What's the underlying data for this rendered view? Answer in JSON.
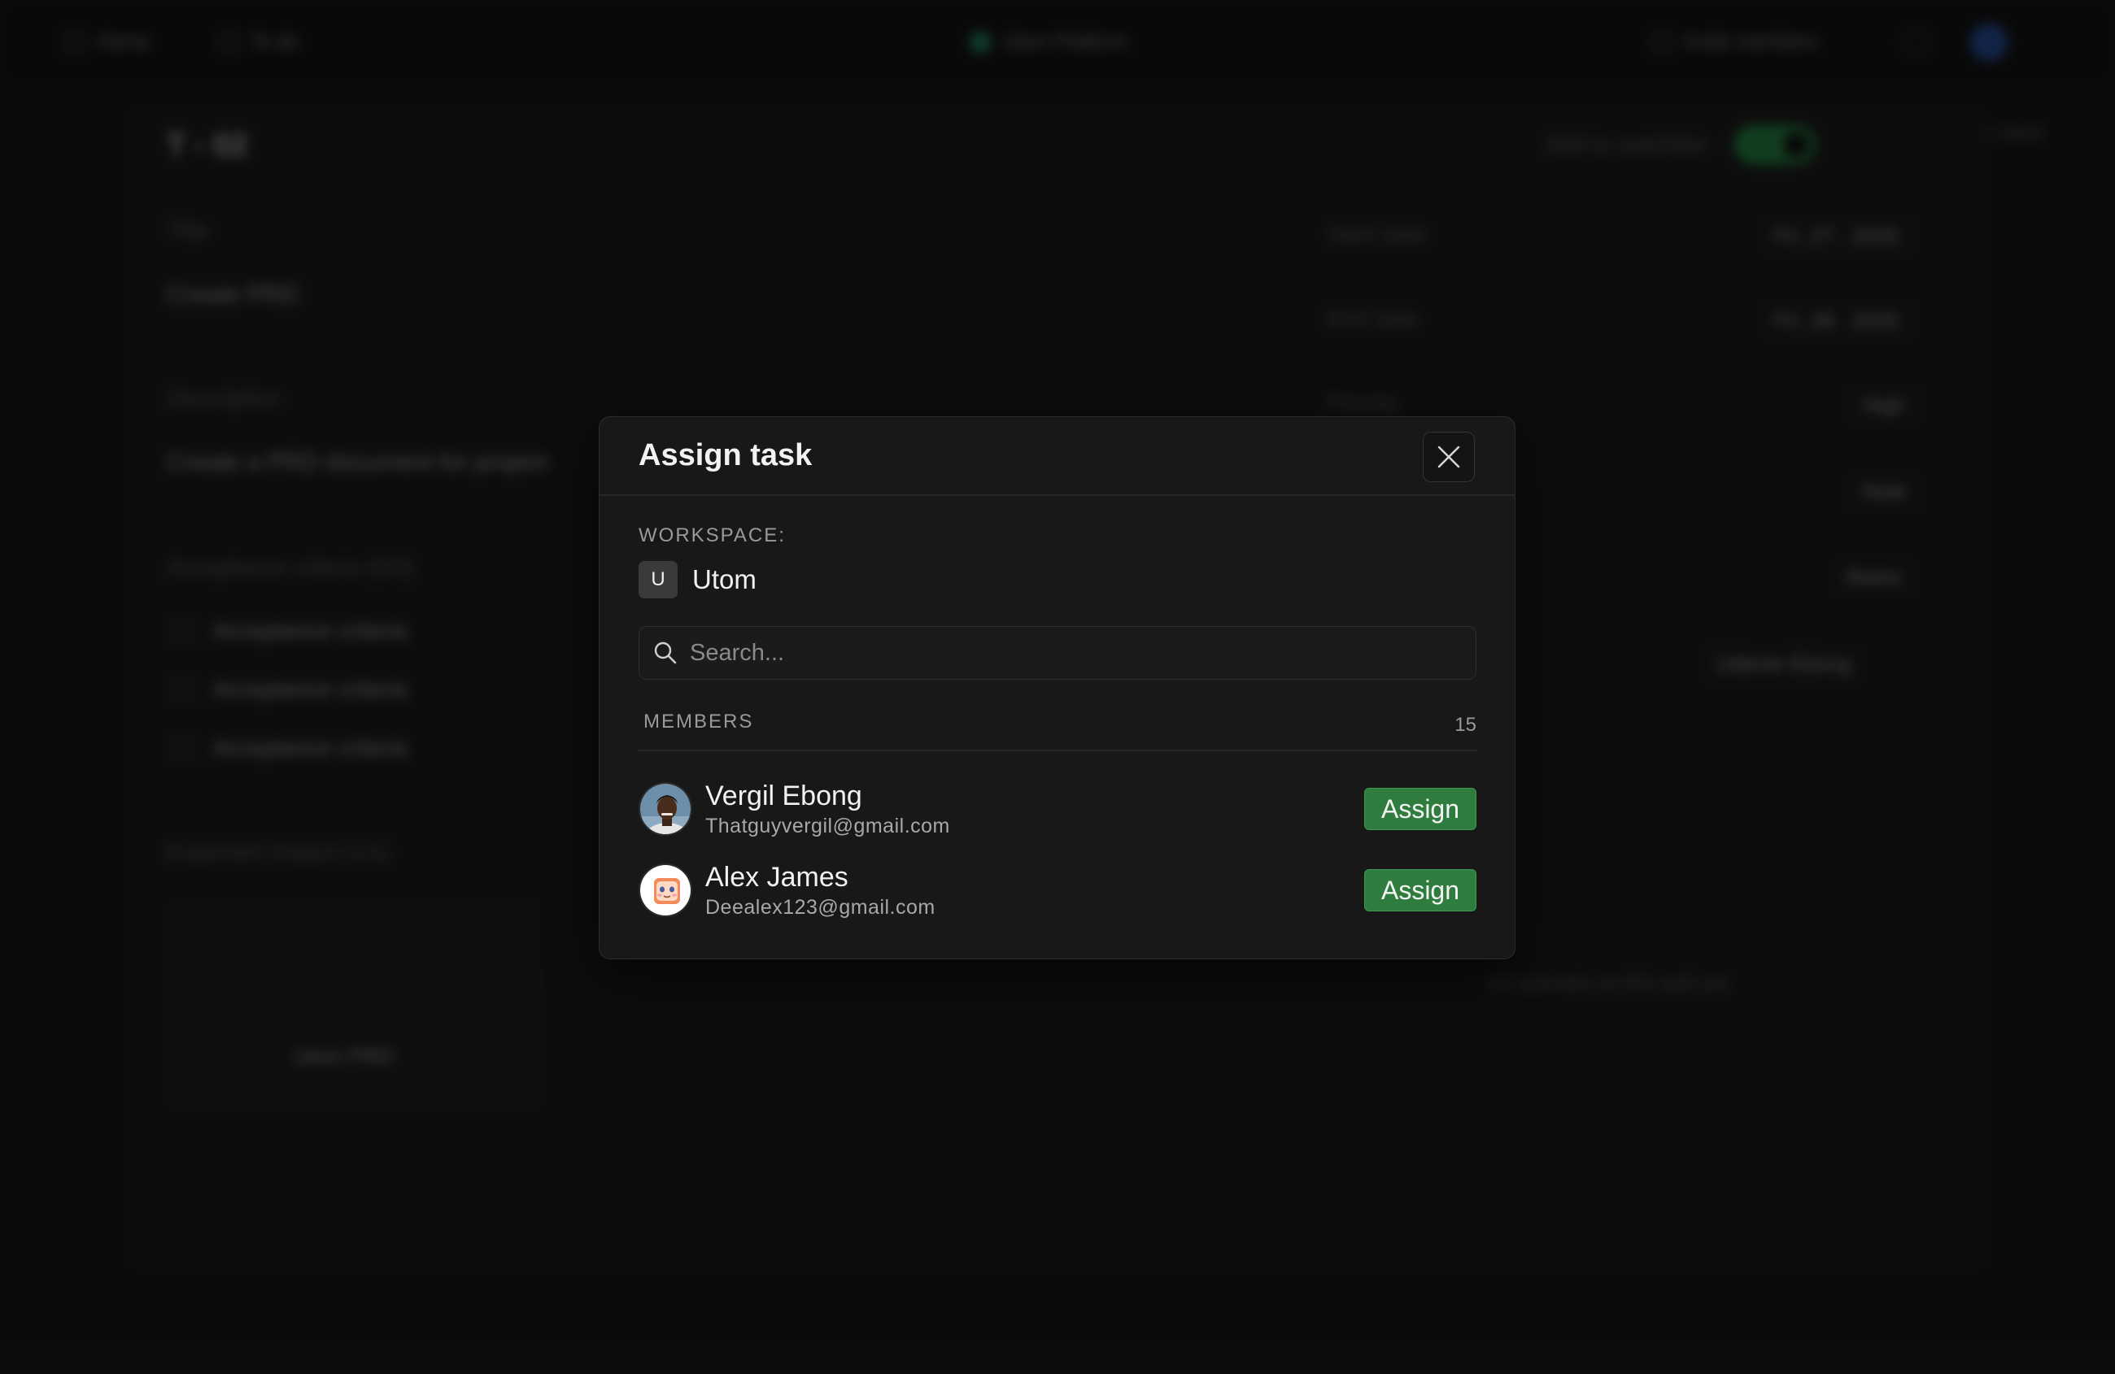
{
  "background": {
    "topbar": {
      "home_label": "Home",
      "todo_label": "To do",
      "project_label": "Utom Platform",
      "invite_label": "Invite members"
    },
    "task": {
      "id": "T - 02",
      "watchlist_label": "Add to watchlist",
      "title_label": "Title",
      "title_value": "Create PRD",
      "description_label": "Description",
      "description_value": "Create a PRD document for project",
      "criteria_label": "Acceptance criteria (0/3)",
      "criteria_items": [
        "Acceptance criteria",
        "Acceptance criteria",
        "Acceptance criteria"
      ],
      "output_label": "Expected Output (1/1)",
      "output_file": "Utom PRD",
      "start_label": "Start date",
      "start_value": "Fri, 27 , 2025",
      "end_label": "End date",
      "end_value": "Fri, 28 , 2025",
      "priority_label": "Priority",
      "priority_value": "High",
      "note_value": "Note",
      "retire_value": "Retire",
      "assignee_value": "Udeme Ebong",
      "activity_empty": "No activities on this task yet",
      "side_label": "< back"
    }
  },
  "modal": {
    "title": "Assign task",
    "workspace_label": "WORKSPACE:",
    "workspace_initial": "U",
    "workspace_name": "Utom",
    "search_placeholder": "Search...",
    "members_label": "MEMBERS",
    "members_count": "15",
    "members": [
      {
        "name": "Vergil Ebong",
        "email": "Thatguyvergil@gmail.com",
        "action": "Assign"
      },
      {
        "name": "Alex James",
        "email": "Deealex123@gmail.com",
        "action": "Assign"
      }
    ]
  },
  "colors": {
    "accent_green": "#2e7d3e",
    "background": "#121212",
    "modal_bg": "#181818"
  }
}
